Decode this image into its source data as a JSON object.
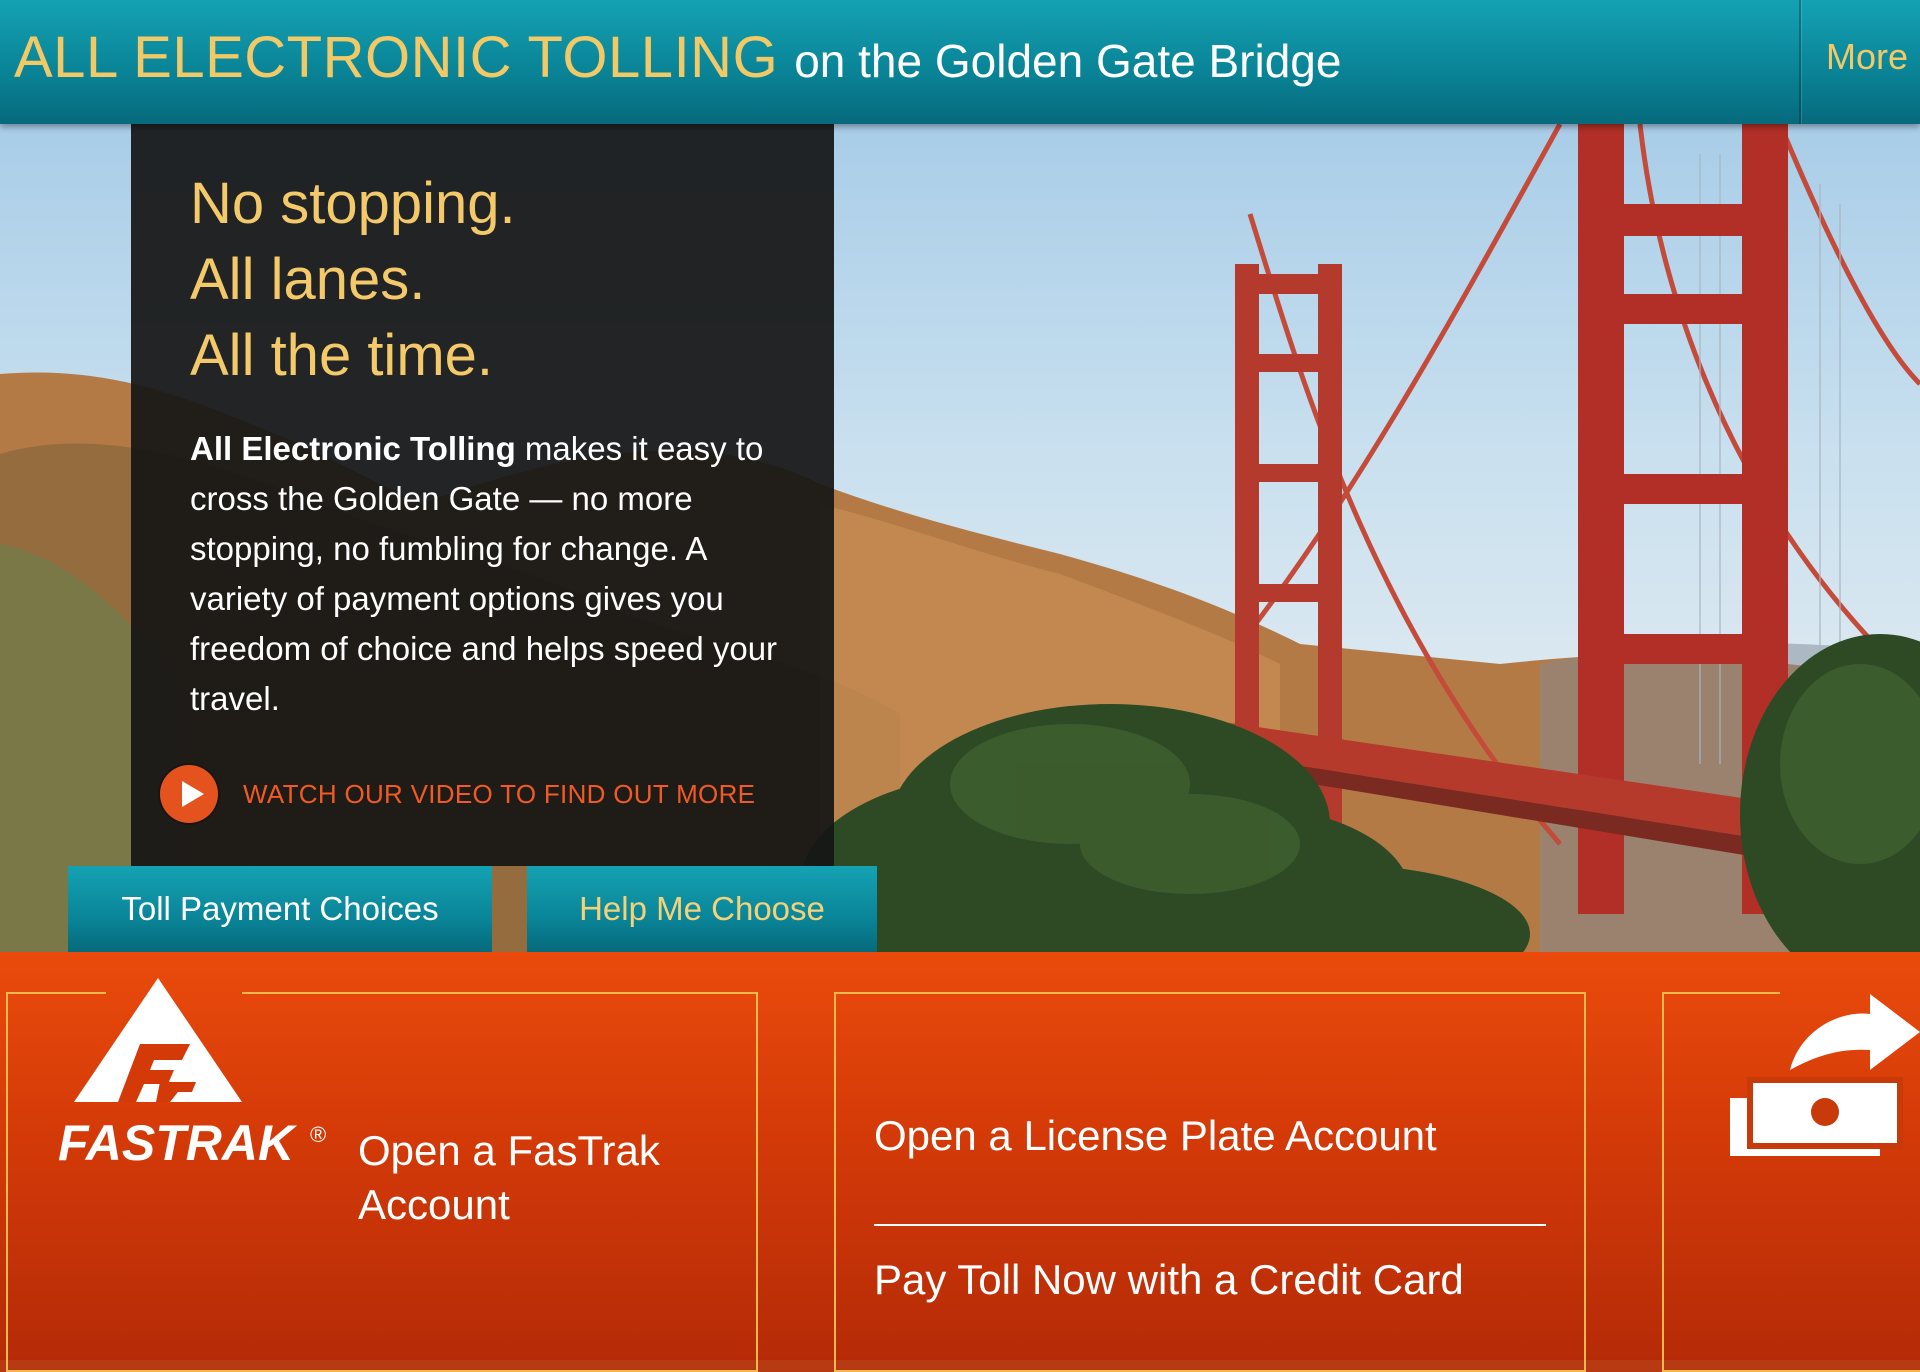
{
  "header": {
    "title_strong": "ALL ELECTRONIC TOLLING",
    "title_rest": "on the Golden Gate Bridge",
    "more_label": "More"
  },
  "promo": {
    "headline": [
      "No stopping.",
      "All lanes.",
      "All the time."
    ],
    "body_bold": "All Electronic Tolling",
    "body_text": " makes it easy to cross the Golden Gate — no more stopping, no fumbling for change. A variety of payment options gives you freedom of choice and helps speed your travel.",
    "video_link": "WATCH OUR VIDEO TO FIND OUT MORE"
  },
  "tabs": {
    "payment_choices": "Toll Payment Choices",
    "help_me_choose": "Help Me Choose"
  },
  "cards": {
    "fastrak_logo_text": "FASTRAK",
    "fastrak_registered": "®",
    "fastrak_link": "Open a FasTrak Account",
    "license_plate_link": "Open a License Plate Account",
    "pay_toll_link": "Pay Toll Now with a Credit Card"
  },
  "colors": {
    "teal": "#0a8598",
    "gold": "#f3c96a",
    "orange": "#e4531d",
    "band_orange": "#d43a08"
  }
}
